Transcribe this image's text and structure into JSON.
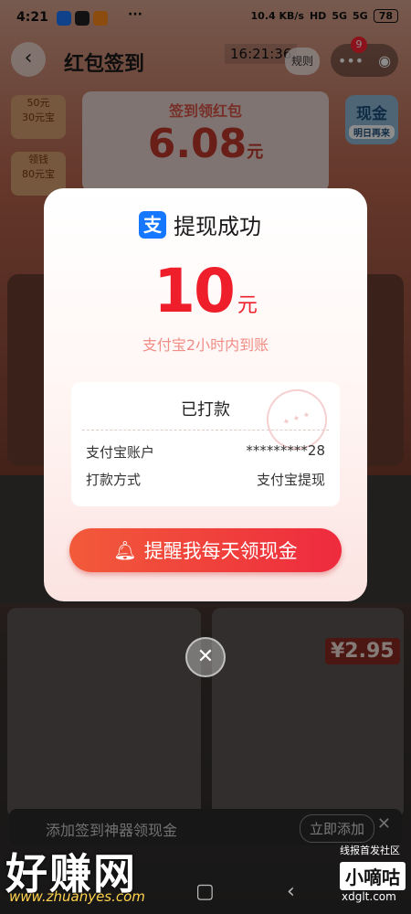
{
  "status_bar": {
    "time": "4:21",
    "more": "···",
    "net_speed": "10.4 KB/s",
    "hd": "HD",
    "sig1": "5G",
    "sig2": "5G",
    "battery": "78"
  },
  "nav": {
    "back_icon": "chevron-left-icon",
    "title": "红包签到",
    "clock": "16:21:36",
    "rules": "规则",
    "capsule_more": "•••",
    "capsule_close": "◉",
    "badge": "9"
  },
  "background": {
    "card_title": "签到领红包",
    "card_amount": "6.08",
    "card_unit": "元",
    "tile1_a": "50元",
    "tile1_b": "30元宝",
    "tile2_a": "领钱",
    "tile2_b": "80元宝",
    "cash_label": "现金",
    "cash_sub": "明日再来",
    "price": "¥2.95",
    "banner_text": "添加签到神器领现金",
    "banner_add": "立即添加",
    "banner_close": "✕"
  },
  "modal": {
    "brand_icon": "alipay-icon",
    "brand_glyph": "支",
    "title": "提现成功",
    "amount": "10",
    "amount_unit": "元",
    "arrival_note": "支付宝2小时内到账",
    "receipt": {
      "status": "已打款",
      "rows": [
        {
          "label": "支付宝账户",
          "value": "*********28"
        },
        {
          "label": "打款方式",
          "value": "支付宝提现"
        }
      ]
    },
    "remind_button": "提醒我每天领现金",
    "close": "✕"
  },
  "watermark": {
    "main": "好赚网",
    "url": "www.zhuanyes.com",
    "right_top": "线报首发社区",
    "right_box": "小嘀咕",
    "right_url": "xdglt.com"
  },
  "colors": {
    "accent_red": "#ee1f2b",
    "button_gradient_start": "#f25a3a",
    "button_gradient_end": "#ee2b3e",
    "alipay_blue": "#1677ff"
  }
}
